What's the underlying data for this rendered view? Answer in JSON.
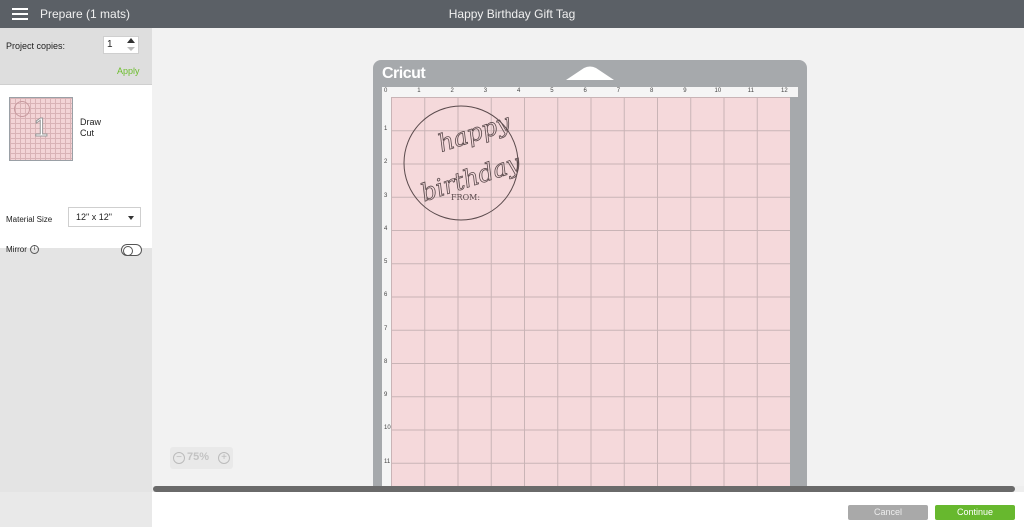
{
  "header": {
    "prepare_label": "Prepare (1 mats)",
    "project_title": "Happy Birthday Gift Tag"
  },
  "sidebar": {
    "copies_label": "Project copies:",
    "copies_value": "1",
    "apply_label": "Apply",
    "mat_number": "1",
    "mat_mode_draw": "Draw",
    "mat_mode_cut": "Cut",
    "material_size_label": "Material Size",
    "material_size_value": "12\" x 12\"",
    "mirror_label": "Mirror",
    "mirror_on": false
  },
  "mat": {
    "brand": "Cricut",
    "ruler_x": [
      "0",
      "1",
      "2",
      "3",
      "4",
      "5",
      "6",
      "7",
      "8",
      "9",
      "10",
      "11",
      "12"
    ],
    "ruler_y": [
      "1",
      "2",
      "3",
      "4",
      "5",
      "6",
      "7",
      "8",
      "9",
      "10",
      "11"
    ]
  },
  "design": {
    "line1": "happy",
    "line2": "birthday",
    "line3": "FROM:"
  },
  "canvas": {
    "zoom_label": "75%"
  },
  "footer": {
    "cancel_label": "Cancel",
    "continue_label": "Continue"
  },
  "colors": {
    "accent_green": "#67b82e",
    "mat_pink": "#f5d9db",
    "header_gray": "#5b6066"
  }
}
